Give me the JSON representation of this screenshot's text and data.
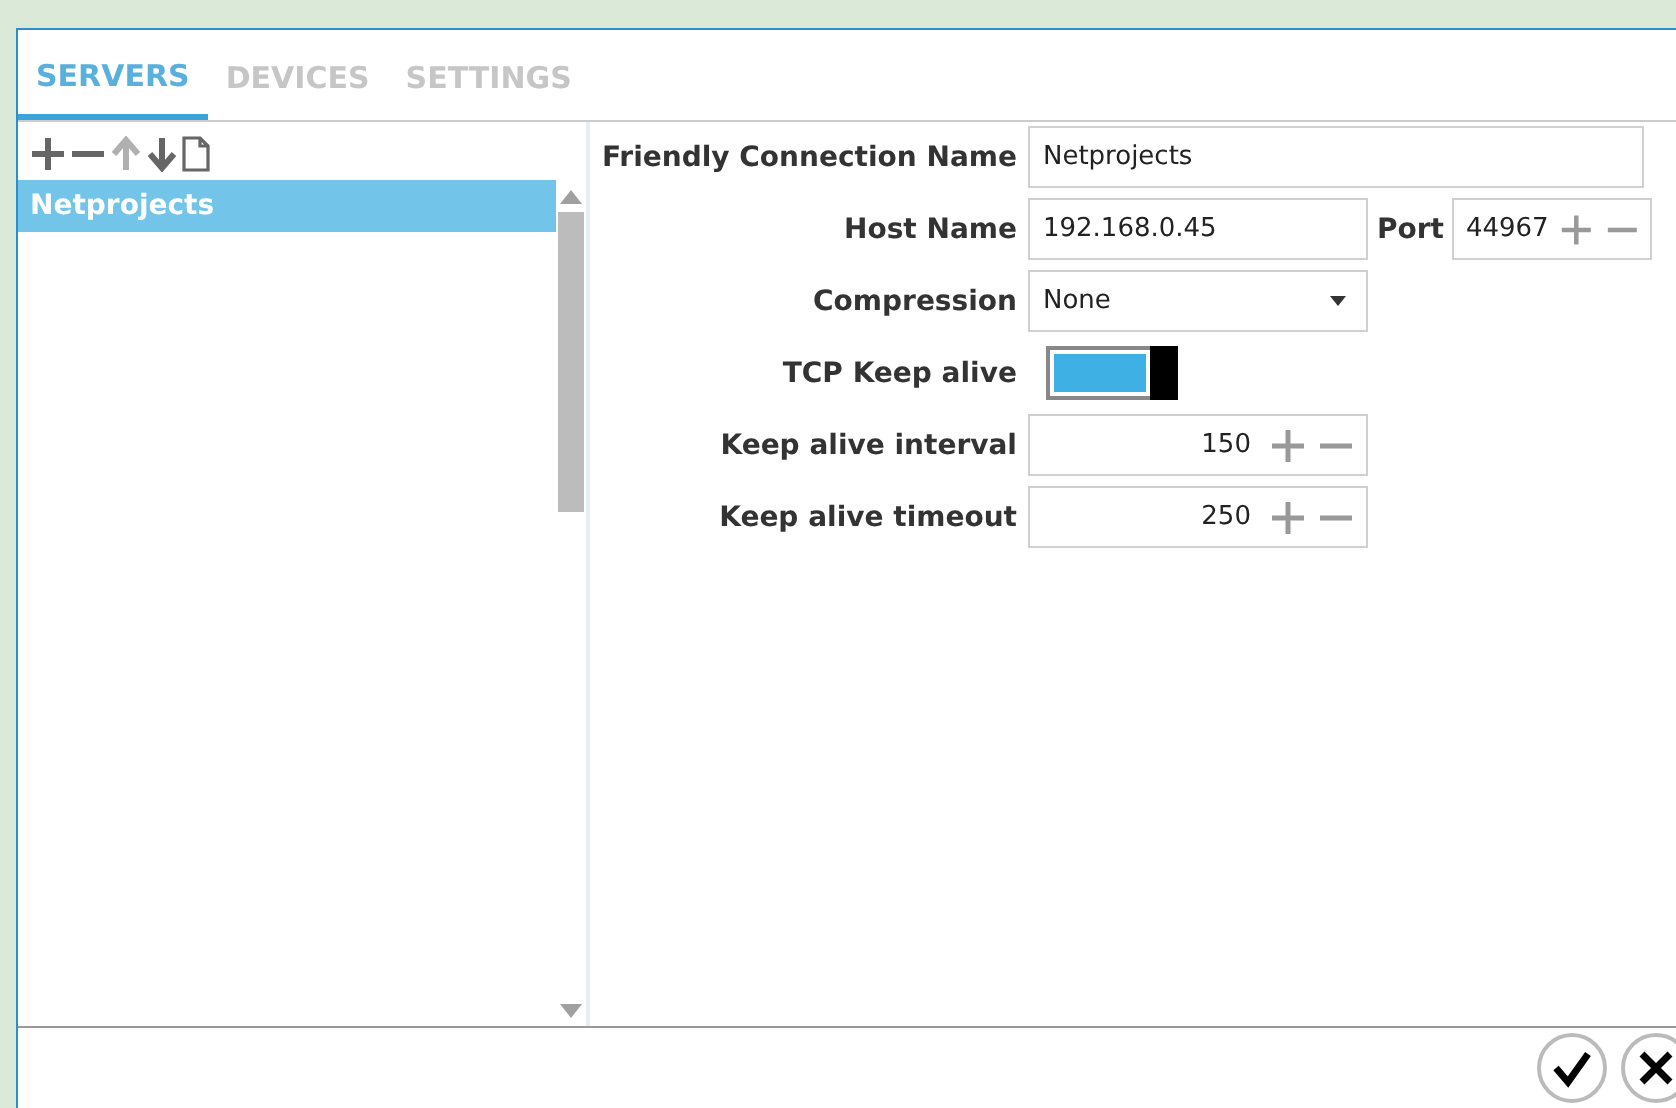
{
  "tabs": [
    {
      "label": "SERVERS",
      "selected": true
    },
    {
      "label": "DEVICES",
      "selected": false
    },
    {
      "label": "SETTINGS",
      "selected": false
    }
  ],
  "toolbar": [
    {
      "kind": "add",
      "disabled": false
    },
    {
      "kind": "remove",
      "disabled": false
    },
    {
      "kind": "up",
      "disabled": true
    },
    {
      "kind": "down",
      "disabled": false
    },
    {
      "kind": "copy",
      "disabled": false
    }
  ],
  "servers": [
    {
      "label": "Netprojects",
      "selected": true
    }
  ],
  "form": [
    {
      "kind": "text",
      "label": "Friendly Connection Name",
      "value": "Netprojects"
    },
    {
      "kind": "host",
      "label": "Host Name",
      "value": "192.168.0.45",
      "port_label": "Port",
      "port": "44967"
    },
    {
      "kind": "dropdown",
      "label": "Compression",
      "value": "None"
    },
    {
      "kind": "toggle",
      "label": "TCP Keep alive",
      "on": true
    },
    {
      "kind": "spinner",
      "label": "Keep alive interval",
      "value": "150"
    },
    {
      "kind": "spinner",
      "label": "Keep alive timeout",
      "value": "250"
    }
  ],
  "actions": [
    {
      "kind": "ok"
    },
    {
      "kind": "cancel"
    }
  ]
}
